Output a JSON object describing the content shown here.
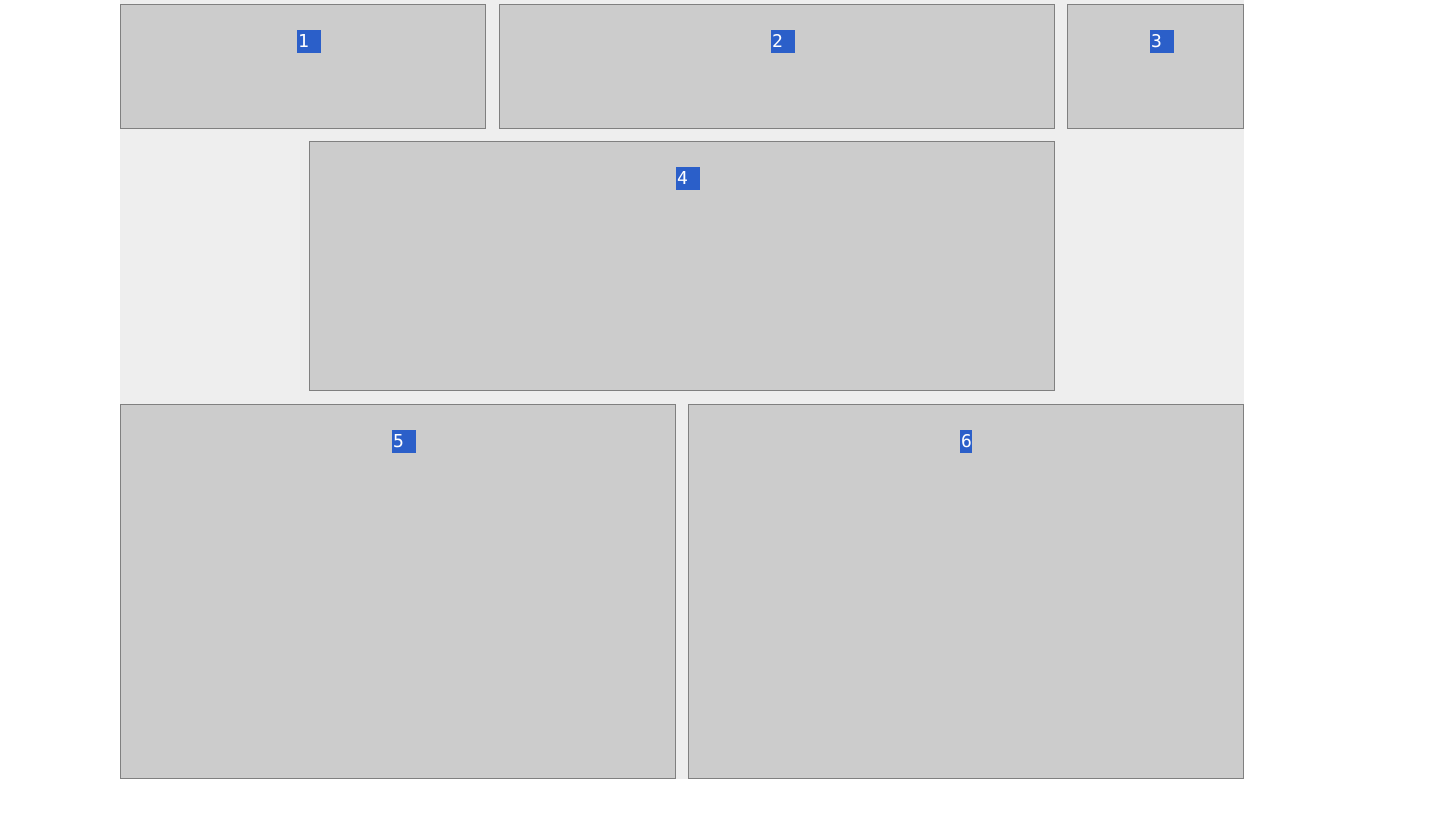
{
  "panels": [
    {
      "label": "1"
    },
    {
      "label": "2"
    },
    {
      "label": "3"
    },
    {
      "label": "4"
    },
    {
      "label": "5"
    },
    {
      "label": "6"
    }
  ],
  "colors": {
    "page_background": "#ffffff",
    "grid_background": "#eeeeee",
    "panel_fill": "#cccccc",
    "panel_border": "#808080",
    "badge_fill": "#2b5fc9",
    "badge_text": "#ffffff"
  }
}
